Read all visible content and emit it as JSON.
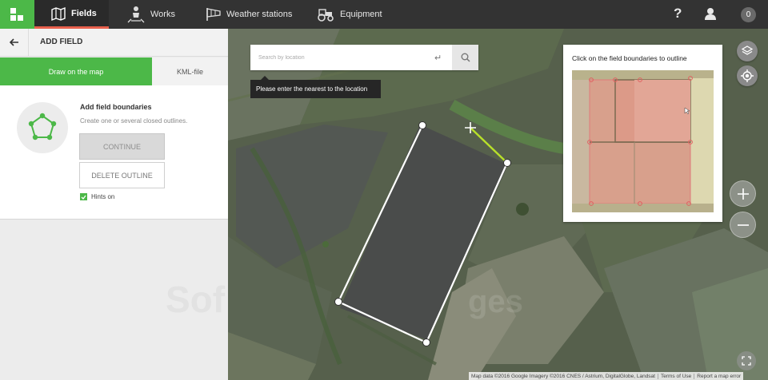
{
  "topbar": {
    "nav": [
      {
        "label": "Fields",
        "icon": "map-book-icon",
        "active": true
      },
      {
        "label": "Works",
        "icon": "farmer-icon",
        "active": false
      },
      {
        "label": "Weather stations",
        "icon": "windsock-icon",
        "active": false
      },
      {
        "label": "Equipment",
        "icon": "tractor-icon",
        "active": false
      }
    ],
    "help_label": "?",
    "notifications_count": "0"
  },
  "panel": {
    "title": "ADD FIELD",
    "tabs": [
      {
        "label": "Draw on the map",
        "active": true
      },
      {
        "label": "KML-file",
        "active": false
      }
    ],
    "hint_title": "Add field boundaries",
    "hint_subtitle": "Create one or several closed outlines.",
    "continue_label": "CONTINUE",
    "delete_label": "DELETE OUTLINE",
    "hints_label": "Hints on",
    "hints_checked": true
  },
  "map": {
    "search_placeholder": "Search by location",
    "search_value": "",
    "enter_glyph": "↵",
    "tooltip": "Please enter the nearest to the location",
    "hint_card_title": "Click on the field boundaries to outline",
    "attribution": "Map data ©2016 Google Imagery ©2016 CNES / Astrium, DigitalGlobe, Landsat",
    "terms_label": "Terms of Use",
    "report_label": "Report a map error",
    "zoom_in": "+",
    "zoom_out": "−"
  },
  "colors": {
    "brand_green": "#4cb848",
    "topbar": "#333333",
    "active_tab_underline": "#e8604c",
    "outline_edge": "#ffffff",
    "drawing_edge": "#b8e02a"
  },
  "watermark": "Softpedia"
}
